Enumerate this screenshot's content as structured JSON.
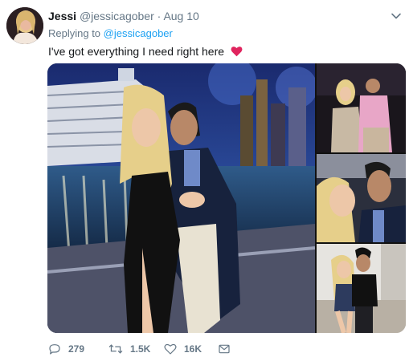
{
  "tweet": {
    "author_name": "Jessi",
    "author_handle": "@jessicagober",
    "separator": "·",
    "date": "Aug 10",
    "reply_prefix": "Replying to",
    "reply_to": "@jessicagober",
    "text": "I've got everything I need right here",
    "emoji": "red-heart"
  },
  "actions": {
    "replies": "279",
    "retweets": "1.5K",
    "likes": "16K"
  },
  "icons": {
    "more": "chevron-down-icon",
    "reply": "reply-icon",
    "retweet": "retweet-icon",
    "like": "heart-icon",
    "message": "envelope-icon"
  },
  "colors": {
    "link": "#1da1f2",
    "muted": "#657786",
    "text": "#14171a",
    "heart_emoji": "#e0245e"
  }
}
